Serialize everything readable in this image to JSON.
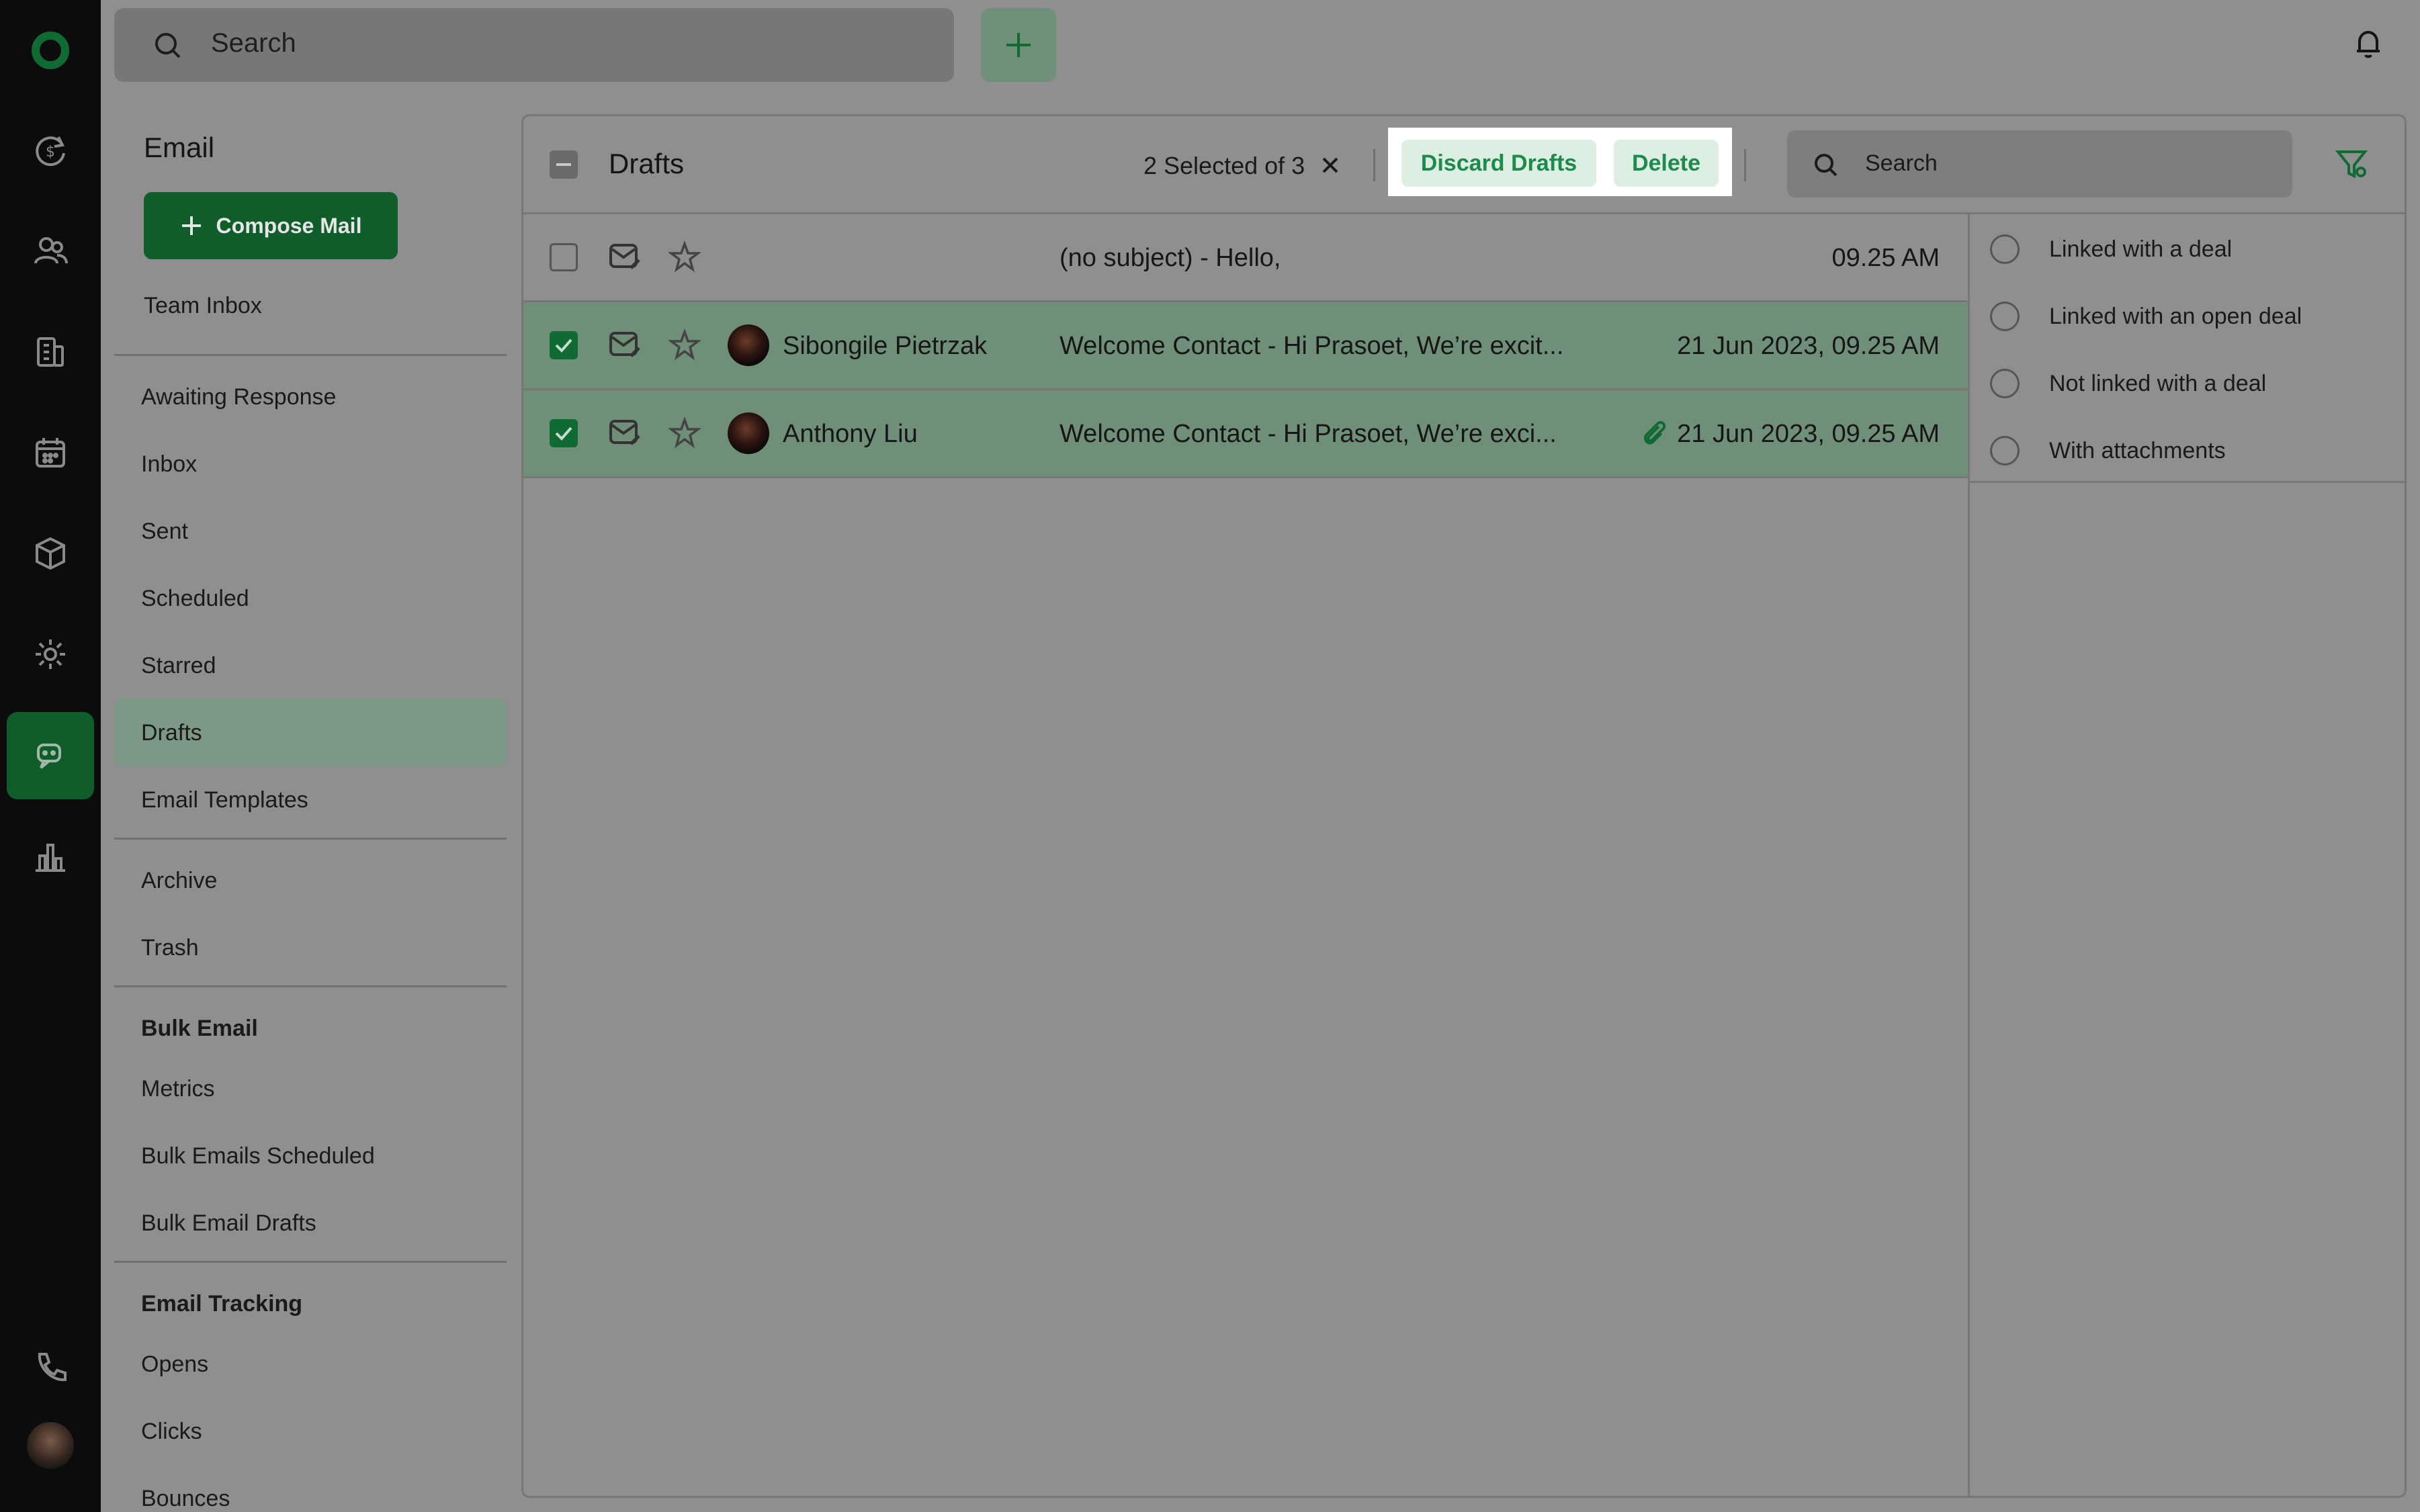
{
  "topbar": {
    "search_placeholder": "Search",
    "add_icon": "plus-icon",
    "notification_icon": "bell-icon"
  },
  "rail": {
    "items": [
      {
        "name": "app-logo",
        "icon": "ring-logo-icon"
      },
      {
        "name": "deals",
        "icon": "money-refresh-icon"
      },
      {
        "name": "contacts",
        "icon": "users-icon"
      },
      {
        "name": "companies",
        "icon": "building-icon"
      },
      {
        "name": "calendar",
        "icon": "calendar-icon"
      },
      {
        "name": "products",
        "icon": "box-icon"
      },
      {
        "name": "settings",
        "icon": "gear-icon"
      },
      {
        "name": "email",
        "icon": "chat-icon",
        "active": true
      },
      {
        "name": "reports",
        "icon": "bar-chart-icon"
      },
      {
        "name": "phone",
        "icon": "phone-icon"
      },
      {
        "name": "profile",
        "icon": "avatar"
      }
    ]
  },
  "sidebar": {
    "title": "Email",
    "compose_label": "Compose Mail",
    "team_inbox": "Team Inbox",
    "group1": [
      "Awaiting Response",
      "Inbox",
      "Sent",
      "Scheduled",
      "Starred",
      "Drafts",
      "Email Templates"
    ],
    "group2": [
      "Archive",
      "Trash"
    ],
    "bulk_heading": "Bulk Email",
    "bulk_items": [
      "Metrics",
      "Bulk Emails Scheduled",
      "Bulk Email Drafts"
    ],
    "tracking_heading": "Email Tracking",
    "tracking_items": [
      "Opens",
      "Clicks",
      "Bounces"
    ],
    "active_item": "Drafts"
  },
  "toolbar": {
    "title": "Drafts",
    "selection_text": "2 Selected of 3",
    "discard_label": "Discard Drafts",
    "delete_label": "Delete",
    "search_placeholder": "Search"
  },
  "emails": [
    {
      "selected": false,
      "sender": "",
      "subject": "(no subject)  -  Hello,",
      "date": "09.25 AM",
      "has_attachment": false
    },
    {
      "selected": true,
      "sender": "Sibongile Pietrzak",
      "subject": "Welcome Contact  -  Hi Prasoet, We’re excit...",
      "date": "21 Jun 2023, 09.25 AM",
      "has_attachment": false
    },
    {
      "selected": true,
      "sender": "Anthony Liu",
      "subject": "Welcome Contact  -  Hi Prasoet, We’re exci...",
      "date": "21 Jun 2023, 09.25 AM",
      "has_attachment": true
    }
  ],
  "filters": [
    "Linked with a deal",
    "Linked with an open deal",
    "Not linked with a deal",
    "With attachments"
  ],
  "colors": {
    "brand_green": "#0f5d2a",
    "accent_green": "#1c8b4b",
    "selected_row": "#6f8f79",
    "overlay_gray": "#8f8f8f"
  }
}
